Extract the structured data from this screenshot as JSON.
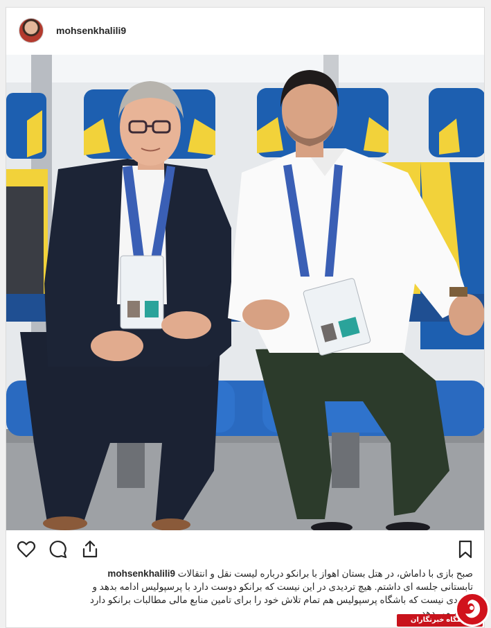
{
  "post": {
    "username": "mohsenkhalili9",
    "caption_user": "mohsenkhalili9",
    "caption_lines": [
      "صبح بازی با داماش، در هتل بستان اهواز با برانکو درباره لیست نقل و انتقالات",
      "تابستانی جلسه ای داشتم. هیچ تردیدی در این نیست که برانکو دوست دارد با پرسپولیس ادامه بدهد و",
      "تردیدی نیست که باشگاه پرسپولیس هم تمام تلاش خود را برای تامین منابع مالی مطالبات برانکو دارد",
      "انجام می دهد."
    ]
  },
  "icons": {
    "like": "heart-icon",
    "comment": "comment-icon",
    "share": "share-icon",
    "save": "bookmark-icon"
  },
  "watermark": {
    "label": "باشگاه خبرنگاران"
  },
  "colors": {
    "seat_blue": "#1d5fb0",
    "seat_yellow": "#f2d23a",
    "brand_red": "#c8131c"
  }
}
